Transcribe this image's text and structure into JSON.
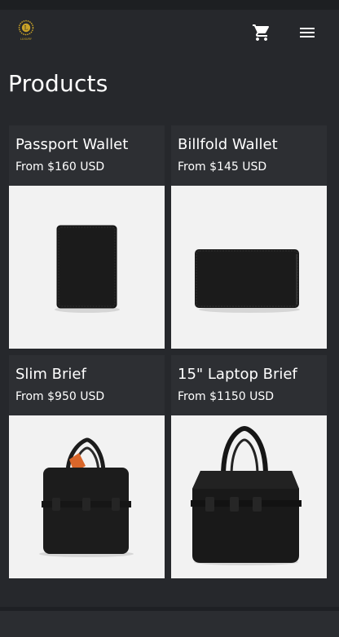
{
  "header": {
    "logo_text": "LUXURY",
    "icons": {
      "logo": "luxury-logo",
      "cart": "shopping-cart-icon",
      "menu": "hamburger-menu-icon"
    },
    "colors": {
      "background": "#26282c",
      "logo_gold": "#c9a227"
    }
  },
  "page": {
    "title": "Products"
  },
  "products": [
    {
      "name": "Passport Wallet",
      "price": "From $160 USD"
    },
    {
      "name": "Billfold Wallet",
      "price": "From $145 USD"
    },
    {
      "name": "Slim Brief",
      "price": "From $950 USD"
    },
    {
      "name": "15\" Laptop Brief",
      "price": "From $1150 USD"
    }
  ]
}
